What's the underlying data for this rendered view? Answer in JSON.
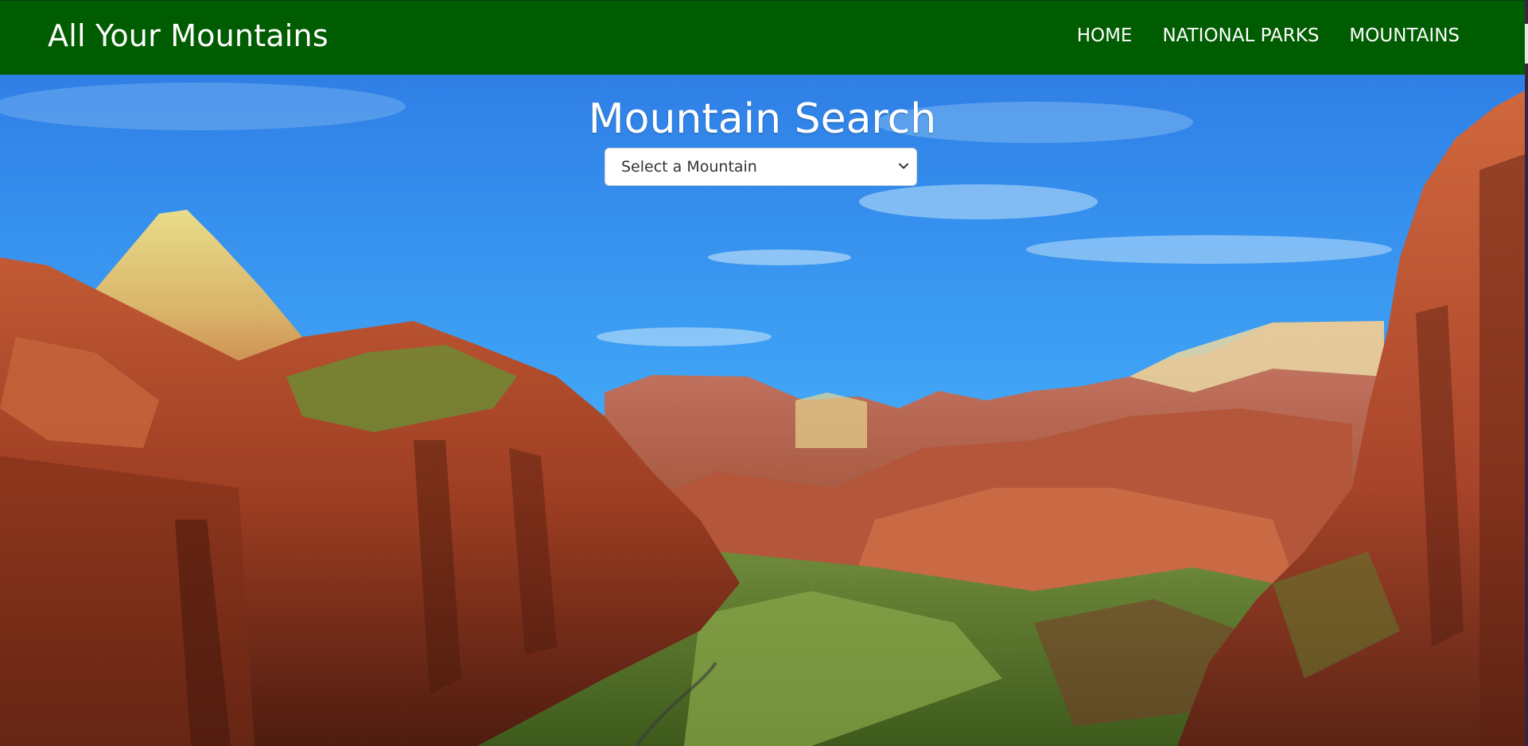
{
  "navbar": {
    "brand": "All Your Mountains",
    "links": [
      {
        "label": "HOME"
      },
      {
        "label": "NATIONAL PARKS"
      },
      {
        "label": "MOUNTAINS"
      }
    ],
    "background_color": "#005c00"
  },
  "hero": {
    "title": "Mountain Search",
    "select": {
      "selected": "Select a Mountain",
      "options": [
        "Select a Mountain"
      ]
    },
    "background_image": "canyon-landscape"
  },
  "colors": {
    "nav_green": "#005c00",
    "sky_blue": "#2f8ef0",
    "rock_red": "#b5432a",
    "text_white": "#ffffff"
  }
}
